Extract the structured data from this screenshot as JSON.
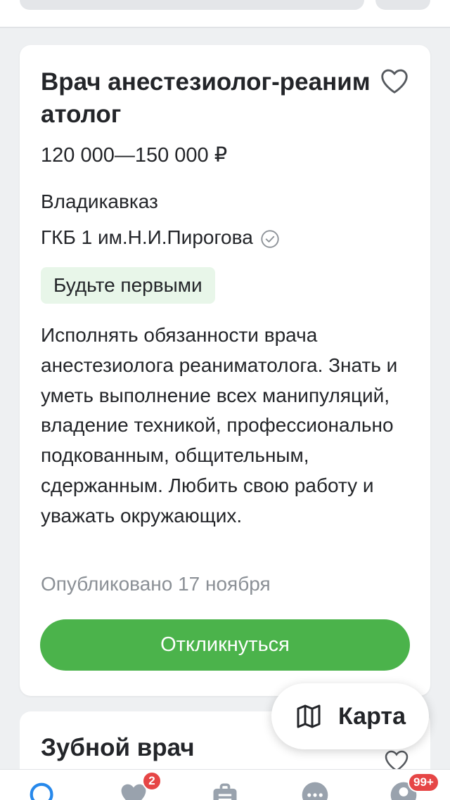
{
  "colors": {
    "accent_green": "#4bb34b",
    "badge_bg": "#e8f6e9",
    "text_primary": "#232529",
    "text_secondary": "#8b9096",
    "nav_blue": "#2688eb",
    "notification_red": "#e64646"
  },
  "vacancy": {
    "title": "Врач анестезиолог-реаниматолог",
    "salary": "120 000—150 000 ₽",
    "city": "Владикавказ",
    "company": "ГКБ 1 им.Н.И.Пирогова",
    "company_verified_icon": "verified-check-icon",
    "badge": "Будьте первыми",
    "description": "Исполнять обязанности врача анестезиолога реаниматолога. Знать и уметь выполнение всех манипуляций, владение техникой, профессионально подкованным, общительным, сдержанным. Любить свою работу и уважать окружающих.",
    "published": "Опубликовано 17 ноября",
    "apply_label": "Откликнуться",
    "favorite_icon": "heart-outline-icon"
  },
  "next_vacancy": {
    "title": "Зубной врач"
  },
  "map_button": {
    "label": "Карта",
    "icon": "map-icon"
  },
  "bottom_nav": {
    "items": [
      {
        "icon": "search-icon"
      },
      {
        "icon": "heart-icon",
        "badge": "2"
      },
      {
        "icon": "briefcase-icon"
      },
      {
        "icon": "chat-icon"
      },
      {
        "icon": "profile-icon",
        "badge": "99+"
      }
    ]
  }
}
